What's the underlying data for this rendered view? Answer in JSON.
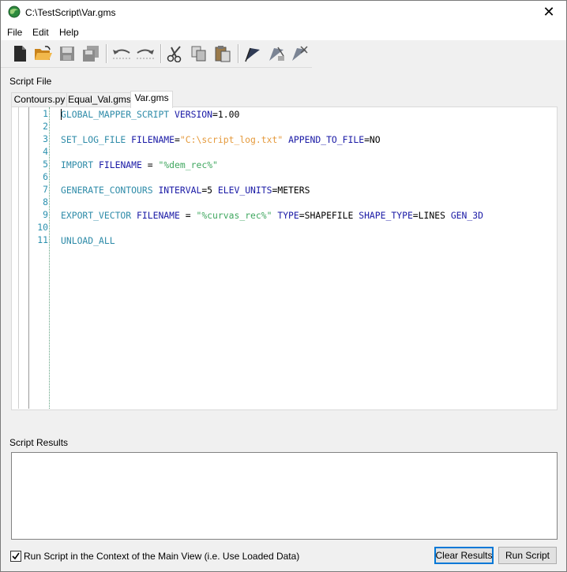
{
  "window": {
    "title": "C:\\TestScript\\Var.gms",
    "close_glyph": "✕"
  },
  "menu": [
    "File",
    "Edit",
    "Help"
  ],
  "toolbar": {
    "buttons": [
      "new-file-icon",
      "open-folder-icon",
      "save-icon",
      "save-all-icon",
      "undo-icon",
      "redo-icon",
      "cut-icon",
      "copy-icon",
      "paste-icon",
      "run-icon",
      "run-selection-icon",
      "run-all-icon"
    ]
  },
  "script_file_label": "Script File",
  "tabs": [
    "Contours.py",
    "Equal_Val.gms",
    "Var.gms"
  ],
  "active_tab": "Var.gms",
  "line_numbers": [
    "1",
    "2",
    "3",
    "4",
    "5",
    "6",
    "7",
    "8",
    "9",
    "10",
    "11"
  ],
  "code": {
    "l1": {
      "cmd": "GLOBAL_MAPPER_SCRIPT",
      "p1": "VERSION",
      "v1": "=1.00"
    },
    "l3": {
      "cmd": "SET_LOG_FILE",
      "p1": "FILENAME",
      "eq": "=",
      "s1": "\"C:\\script_log.txt\"",
      "p2": "APPEND_TO_FILE",
      "v2": "=NO"
    },
    "l5": {
      "cmd": "IMPORT",
      "p1": "FILENAME",
      "eq": " = ",
      "s1": "\"%dem_rec%\""
    },
    "l7": {
      "cmd": "GENERATE_CONTOURS",
      "p1": "INTERVAL",
      "v1": "=5",
      "p2": "ELEV_UNITS",
      "v2": "=METERS"
    },
    "l9": {
      "cmd": "EXPORT_VECTOR",
      "p1": "FILENAME",
      "eq": " = ",
      "s1": "\"%curvas_rec%\"",
      "p2": "TYPE",
      "v2": "=SHAPEFILE",
      "p3": "SHAPE_TYPE",
      "v3": "=LINES",
      "p4": "GEN_3D"
    },
    "l11": {
      "cmd": "UNLOAD_ALL"
    }
  },
  "script_results_label": "Script Results",
  "results_text": "",
  "checkbox": {
    "label": "Run Script in the Context of the Main View (i.e. Use Loaded Data)",
    "checked": true
  },
  "buttons": {
    "clear": "Clear Results",
    "run": "Run Script"
  },
  "colors": {
    "keyword": "#1a1aa6",
    "command": "#2e8ba8",
    "string": "#e59a3c",
    "percent_string": "#3fa75f",
    "line_number": "#2b91af"
  }
}
